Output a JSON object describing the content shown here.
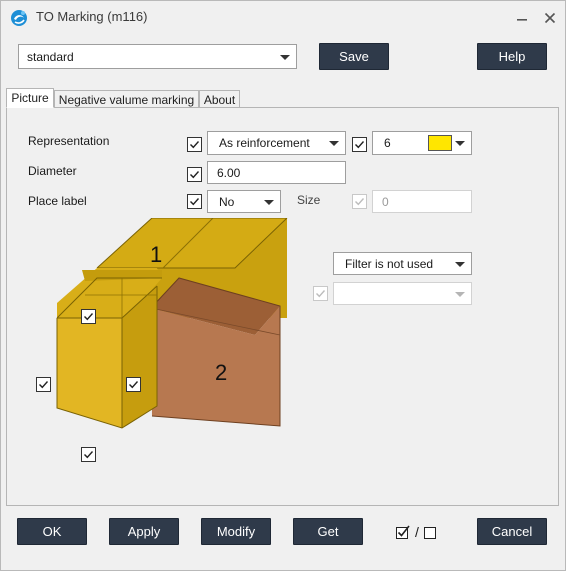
{
  "window": {
    "title": "TO Marking (m116)"
  },
  "top": {
    "preset_value": "standard",
    "save_label": "Save",
    "help_label": "Help"
  },
  "tabs": [
    {
      "label": "Picture",
      "active": true
    },
    {
      "label": "Negative valume marking",
      "active": false
    },
    {
      "label": "About",
      "active": false
    }
  ],
  "form": {
    "representation_label": "Representation",
    "representation_value": "As reinforcement",
    "color_number": "6",
    "color_swatch": "#ffe600",
    "diameter_label": "Diameter",
    "diameter_value": "6.00",
    "place_label_label": "Place label",
    "place_label_value": "No",
    "size_label": "Size",
    "size_value": "0",
    "filter_value": "Filter is not used",
    "filter_secondary_value": ""
  },
  "picture": {
    "part1_label": "1",
    "part2_label": "2"
  },
  "bottom": {
    "ok_label": "OK",
    "apply_label": "Apply",
    "modify_label": "Modify",
    "get_label": "Get",
    "toggle_separator": "/",
    "cancel_label": "Cancel"
  }
}
